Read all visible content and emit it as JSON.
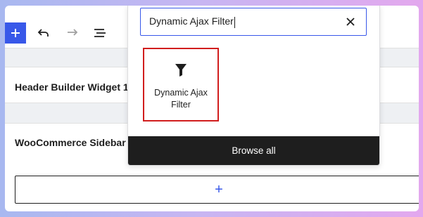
{
  "toolbar": {
    "add_icon": "plus-icon",
    "undo_icon": "undo-icon",
    "redo_icon": "redo-icon",
    "list_view_icon": "list-view-icon"
  },
  "editor": {
    "rows": [
      {
        "title": "Header Builder Widget 1"
      },
      {
        "title": "WooCommerce Sidebar"
      }
    ],
    "add_block_label": "+"
  },
  "inserter": {
    "search": {
      "value": "Dynamic Ajax Filter",
      "clear_icon": "close-icon"
    },
    "results": [
      {
        "line1": "Dynamic Ajax",
        "line2": "Filter",
        "icon": "funnel-icon"
      }
    ],
    "browse_all_label": "Browse all"
  },
  "colors": {
    "accent": "#3858e9",
    "highlight_border": "#d11d1d",
    "dark": "#1e1e1e"
  }
}
